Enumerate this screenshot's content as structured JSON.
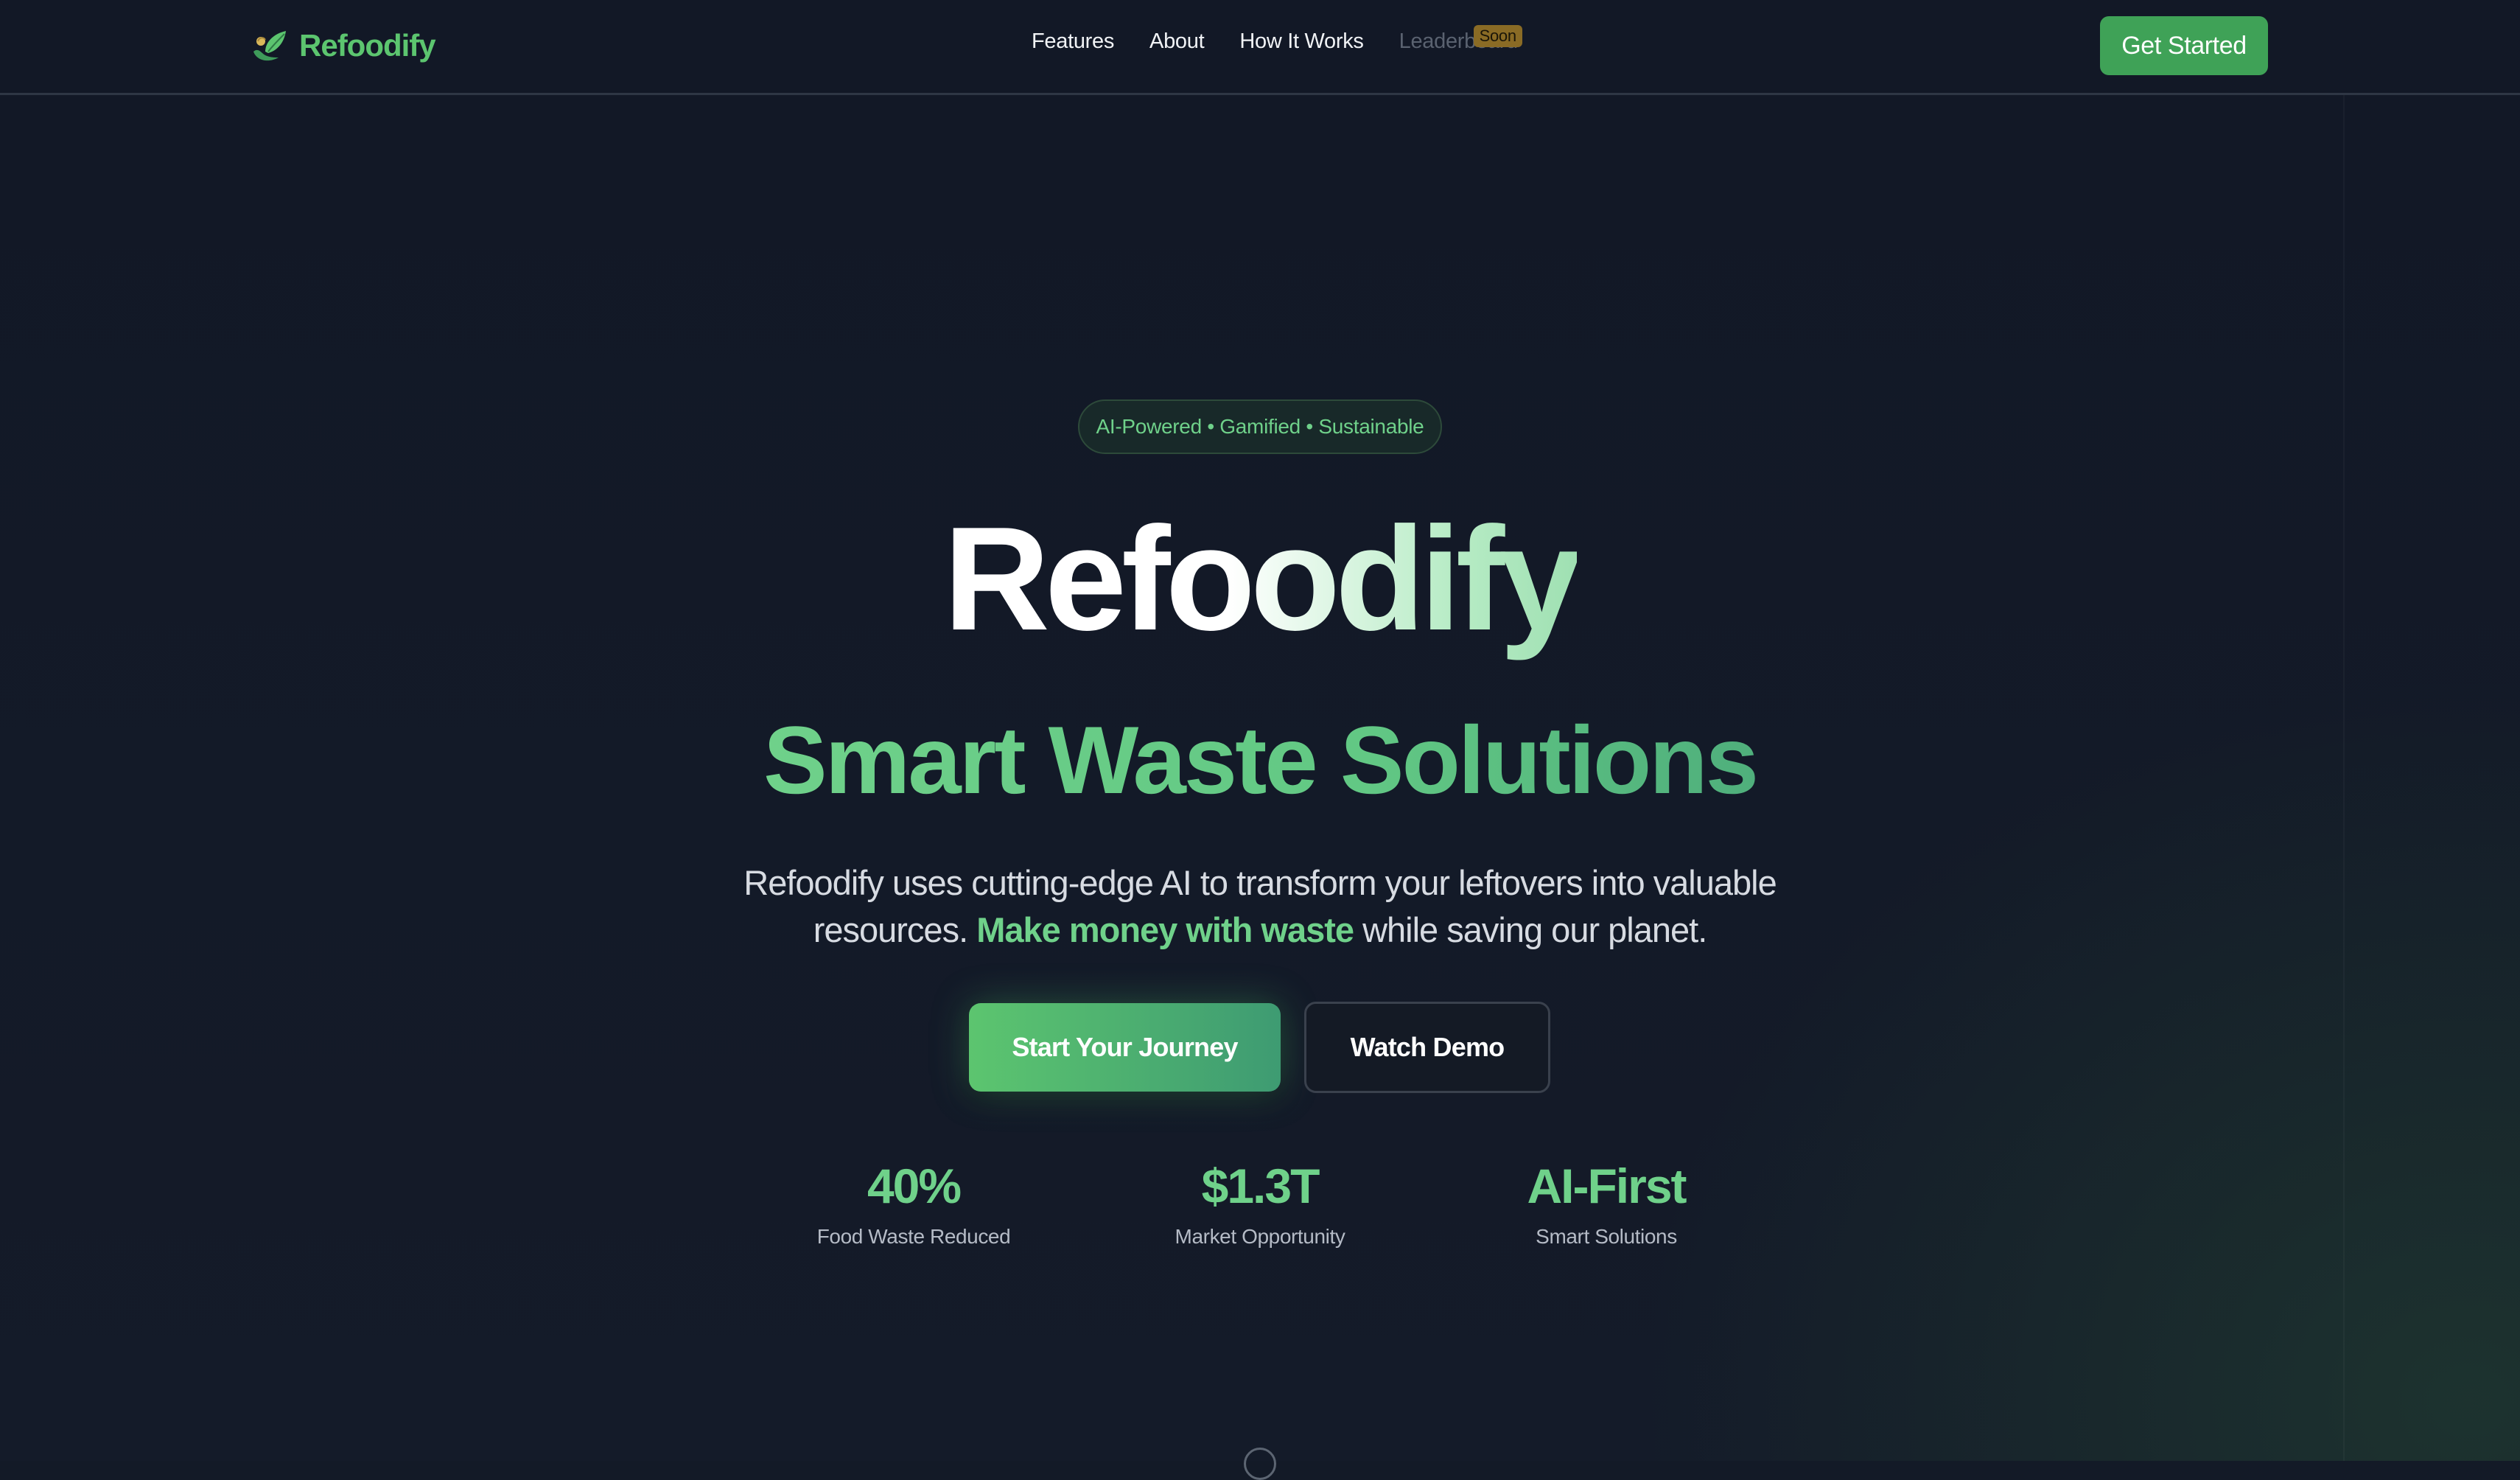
{
  "navbar": {
    "logo_text": "Refoodify",
    "logo_icon": "leaf-hand-icon",
    "links": [
      {
        "label": "Features"
      },
      {
        "label": "About"
      },
      {
        "label": "How It Works"
      },
      {
        "label": "Leaderboard",
        "badge": "Soon",
        "disabled": true
      }
    ],
    "cta_label": "Get Started"
  },
  "hero": {
    "tagline": "AI-Powered • Gamified • Sustainable",
    "title": "Refoodify",
    "subtitle": "Smart Waste Solutions",
    "description_part1": "Refoodify uses cutting-edge AI to transform your leftovers into valuable resources.",
    "description_highlight": "Make money with waste",
    "description_part2": "while saving our planet.",
    "primary_cta": "Start Your Journey",
    "secondary_cta": "Watch Demo"
  },
  "stats": [
    {
      "value": "40%",
      "label": "Food Waste Reduced"
    },
    {
      "value": "$1.3T",
      "label": "Market Opportunity"
    },
    {
      "value": "AI-First",
      "label": "Smart Solutions"
    }
  ],
  "colors": {
    "background": "#131a27",
    "accent_green": "#5cc56f",
    "button_green": "#3fa257",
    "text_primary": "#ffffff",
    "text_muted": "#b5bbc6",
    "badge_gold": "#8a6b25"
  }
}
